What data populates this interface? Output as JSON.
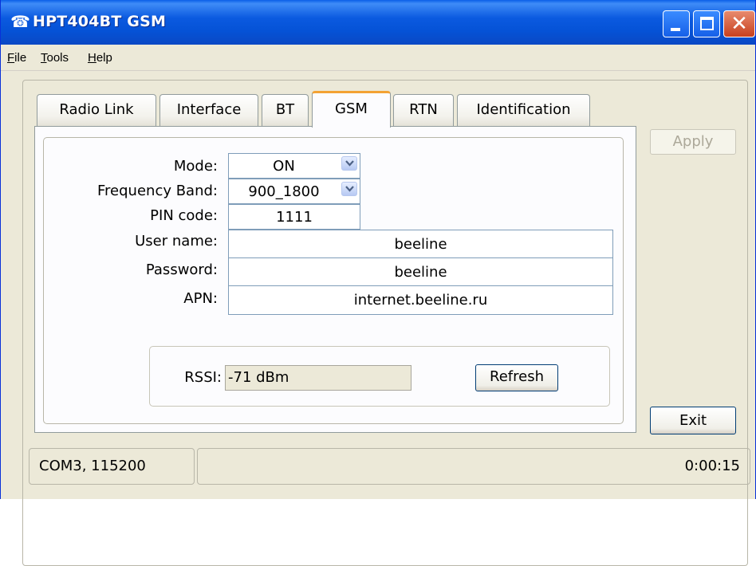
{
  "window": {
    "title": "HPT404BT GSM",
    "icon": "phone-handset-icon"
  },
  "menu": [
    {
      "label": "File"
    },
    {
      "label": "Tools"
    },
    {
      "label": "Help"
    }
  ],
  "tabs": [
    {
      "label": "Radio Link"
    },
    {
      "label": "Interface"
    },
    {
      "label": "BT"
    },
    {
      "label": "GSM",
      "active": true
    },
    {
      "label": "RTN"
    },
    {
      "label": "Identification"
    }
  ],
  "form": {
    "mode_label": "Mode:",
    "mode_value": "ON",
    "band_label": "Frequency Band:",
    "band_value": "900_1800",
    "pin_label": "PIN code:",
    "pin_value": "1111",
    "user_label": "User name:",
    "user_value": "beeline",
    "password_label": "Password:",
    "password_value": "beeline",
    "apn_label": "APN:",
    "apn_value": "internet.beeline.ru"
  },
  "rssi": {
    "label": "RSSI:",
    "value": "-71 dBm",
    "refresh_label": "Refresh"
  },
  "buttons": {
    "apply_label": "Apply",
    "exit_label": "Exit"
  },
  "status": {
    "connection": "COM3, 115200",
    "message": "",
    "elapsed": "0:00:15"
  },
  "colors": {
    "titlebar": "#0a5fe8",
    "active_tab_accent": "#f3a233",
    "window_bg": "#ece9d8"
  }
}
